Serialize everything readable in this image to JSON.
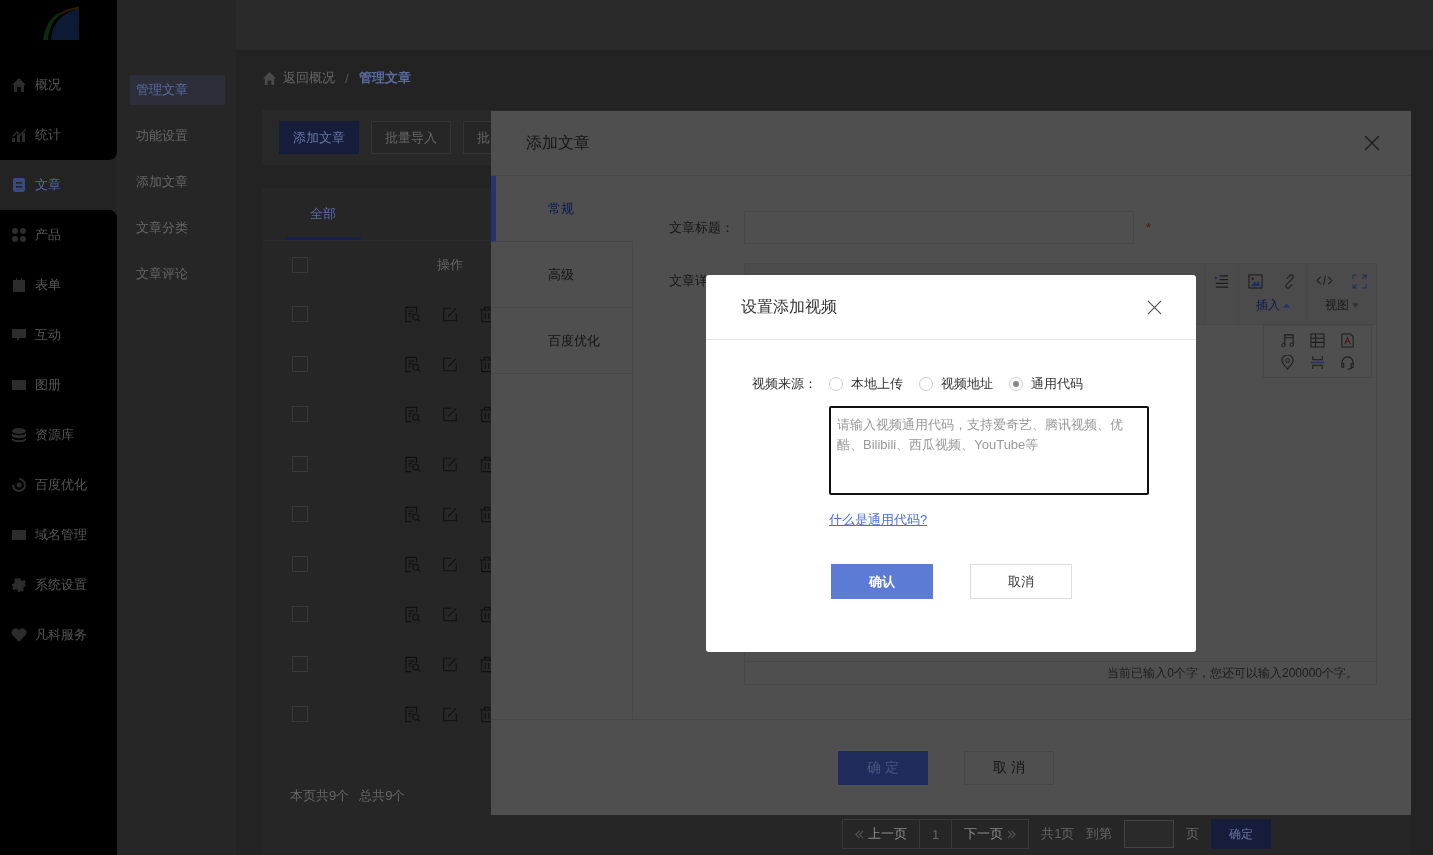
{
  "sidebar": {
    "items": [
      {
        "label": "概况",
        "selected": false
      },
      {
        "label": "统计",
        "selected": false
      },
      {
        "label": "文章",
        "selected": true
      },
      {
        "label": "产品",
        "selected": false
      },
      {
        "label": "表单",
        "selected": false
      },
      {
        "label": "互动",
        "selected": false
      },
      {
        "label": "图册",
        "selected": false
      },
      {
        "label": "资源库",
        "selected": false
      },
      {
        "label": "百度优化",
        "selected": false
      },
      {
        "label": "域名管理",
        "selected": false
      },
      {
        "label": "系统设置",
        "selected": false
      },
      {
        "label": "凡科服务",
        "selected": false
      }
    ]
  },
  "submenu": {
    "items": [
      {
        "label": "管理文章",
        "selected": true
      },
      {
        "label": "功能设置",
        "selected": false
      },
      {
        "label": "添加文章",
        "selected": false
      },
      {
        "label": "文章分类",
        "selected": false
      },
      {
        "label": "文章评论",
        "selected": false
      }
    ]
  },
  "breadcrumb": {
    "back": "返回概况",
    "separator": "/",
    "current": "管理文章"
  },
  "toolbar": {
    "buttons": [
      {
        "label": "添加文章",
        "kind": "primary"
      },
      {
        "label": "批量导入",
        "kind": "default"
      },
      {
        "label": "批",
        "kind": "default"
      }
    ]
  },
  "tabs": [
    {
      "label": "全部",
      "selected": true
    }
  ],
  "table": {
    "header": {
      "checked": false,
      "actions": "操作"
    },
    "rows": [
      {
        "checked": false
      },
      {
        "checked": false
      },
      {
        "checked": false
      },
      {
        "checked": false
      },
      {
        "checked": false
      },
      {
        "checked": false
      },
      {
        "checked": false
      },
      {
        "checked": false
      },
      {
        "checked": false
      }
    ]
  },
  "summary": {
    "page_count": "本页共9个",
    "total": "总共9个"
  },
  "pagination": {
    "prev": "上一页",
    "page": "1",
    "next": "下一页",
    "total_pages": "共1页",
    "goto_label": "到第",
    "goto_unit": "页",
    "goto_button": "确定"
  },
  "article_dialog": {
    "title": "添加文章",
    "tabs": [
      {
        "label": "常规",
        "selected": true
      },
      {
        "label": "高级",
        "selected": false
      },
      {
        "label": "百度优化",
        "selected": false
      }
    ],
    "title_label": "文章标题：",
    "required": "*",
    "detail_label": "文章详",
    "editor": {
      "menus": [
        {
          "label": "插入",
          "expanded": true
        },
        {
          "label": "视图",
          "expanded": false
        }
      ],
      "status": "当前已输入0个字，您还可以输入200000个字。"
    },
    "confirm": "确 定",
    "cancel": "取 消"
  },
  "video_dialog": {
    "title": "设置添加视频",
    "source_label": "视频来源：",
    "options": [
      {
        "label": "本地上传",
        "selected": false
      },
      {
        "label": "视频地址",
        "selected": false
      },
      {
        "label": "通用代码",
        "selected": true
      }
    ],
    "placeholder": "请输入视频通用代码，支持爱奇艺、腾讯视频、优酷、Bilibili、西瓜视频、YouTube等",
    "help_link": "什么是通用代码?",
    "confirm": "确认",
    "cancel": "取消"
  }
}
